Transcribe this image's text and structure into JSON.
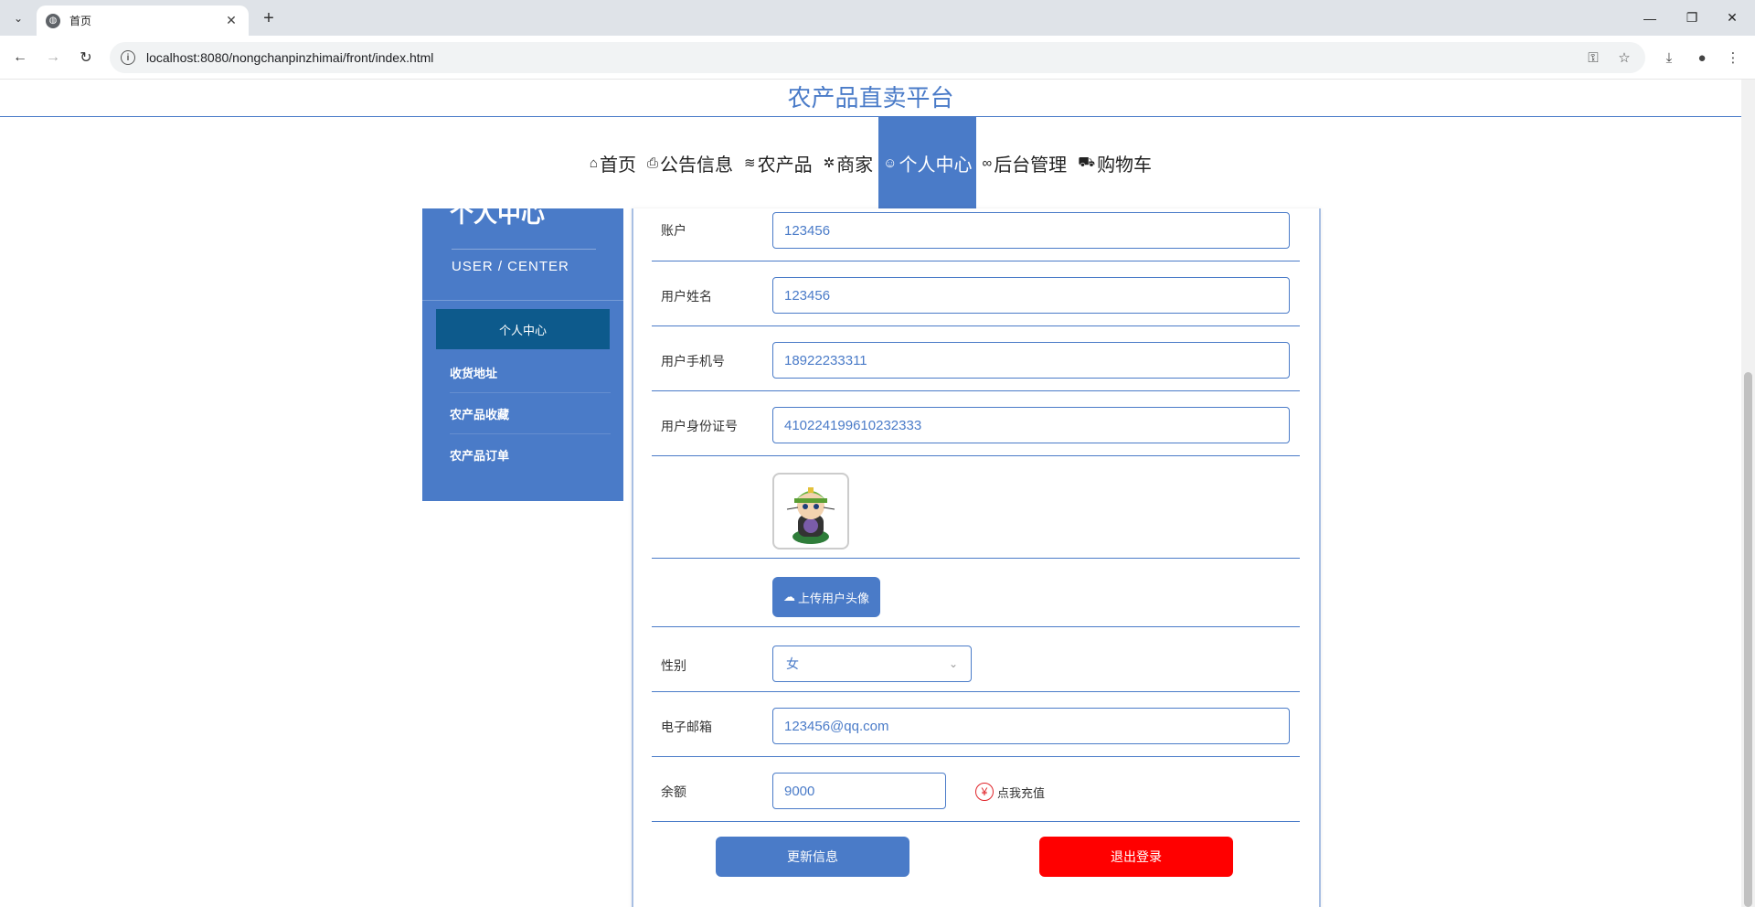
{
  "browser": {
    "tab_title": "首页",
    "url": "localhost:8080/nongchanpinzhimai/front/index.html"
  },
  "site": {
    "title": "农产品直卖平台"
  },
  "nav": {
    "items": [
      {
        "label": "首页",
        "icon": "home-icon"
      },
      {
        "label": "公告信息",
        "icon": "notice-icon"
      },
      {
        "label": "农产品",
        "icon": "layers-icon"
      },
      {
        "label": "商家",
        "icon": "shop-icon"
      },
      {
        "label": "个人中心",
        "icon": "user-icon",
        "active": true
      },
      {
        "label": "后台管理",
        "icon": "link-icon"
      },
      {
        "label": "购物车",
        "icon": "cart-icon"
      }
    ]
  },
  "sidebar": {
    "title": "个人中心",
    "subtitle": "USER / CENTER",
    "items": [
      "个人中心",
      "收货地址",
      "农产品收藏",
      "农产品订单"
    ]
  },
  "form": {
    "account_label": "账户",
    "account_value": "123456",
    "name_label": "用户姓名",
    "name_value": "123456",
    "phone_label": "用户手机号",
    "phone_value": "18922233311",
    "idcard_label": "用户身份证号",
    "idcard_value": "410224199610232333",
    "upload_label": "上传用户头像",
    "gender_label": "性别",
    "gender_value": "女",
    "email_label": "电子邮箱",
    "email_value": "123456@qq.com",
    "balance_label": "余额",
    "balance_value": "9000",
    "recharge_label": "点我充值",
    "update_button": "更新信息",
    "logout_button": "退出登录"
  },
  "colors": {
    "primary": "#4a7bc8",
    "sidebar_active": "#0d5a8c",
    "danger": "#ff0000"
  }
}
